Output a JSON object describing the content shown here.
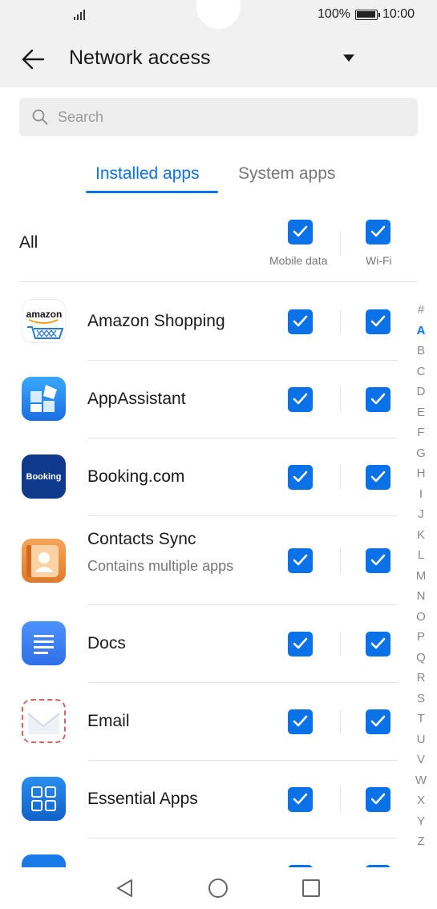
{
  "status_bar": {
    "battery": "100%",
    "time": "10:00"
  },
  "header": {
    "title": "Network access"
  },
  "search": {
    "placeholder": "Search"
  },
  "tabs": [
    {
      "label": "Installed apps",
      "active": true
    },
    {
      "label": "System apps",
      "active": false
    }
  ],
  "all_row": {
    "label": "All",
    "mobile_label": "Mobile data",
    "wifi_label": "Wi-Fi"
  },
  "apps": [
    {
      "name": "Amazon Shopping",
      "subtitle": "",
      "icon": "amazon-shopping-icon",
      "icon_text": "amazon"
    },
    {
      "name": "AppAssistant",
      "subtitle": "",
      "icon": "appassistant-icon",
      "icon_text": ""
    },
    {
      "name": "Booking.com",
      "subtitle": "",
      "icon": "booking-icon",
      "icon_text": "Booking"
    },
    {
      "name": "Contacts Sync",
      "subtitle": "Contains multiple apps",
      "icon": "contacts-sync-icon",
      "icon_text": ""
    },
    {
      "name": "Docs",
      "subtitle": "",
      "icon": "docs-icon",
      "icon_text": ""
    },
    {
      "name": "Email",
      "subtitle": "",
      "icon": "email-icon",
      "icon_text": ""
    },
    {
      "name": "Essential Apps",
      "subtitle": "",
      "icon": "essential-apps-icon",
      "icon_text": ""
    }
  ],
  "alphabet_index": [
    "#",
    "A",
    "B",
    "C",
    "D",
    "E",
    "F",
    "G",
    "H",
    "I",
    "J",
    "K",
    "L",
    "M",
    "N",
    "O",
    "P",
    "Q",
    "R",
    "S",
    "T",
    "U",
    "V",
    "W",
    "X",
    "Y",
    "Z"
  ],
  "alphabet_active": "A",
  "colors": {
    "accent": "#0a72e6",
    "header_bg": "#f1f1f1"
  }
}
